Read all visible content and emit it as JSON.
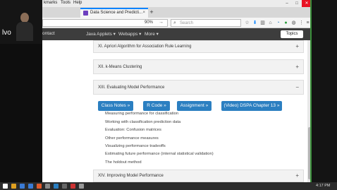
{
  "webcam": {
    "name": "lvo"
  },
  "menubar": {
    "items": [
      "kmarks",
      "Tools",
      "Help"
    ]
  },
  "window_controls": {
    "minimize": "–",
    "maximize": "□",
    "close": "✕"
  },
  "tab": {
    "title": "Data Science and Predicti...",
    "close": "×"
  },
  "newtab": "+",
  "navbar": {
    "zoom": "90%",
    "go": "→",
    "search_placeholder": "Search"
  },
  "site_nav": {
    "items": [
      "ontact",
      "Java Applets ▾",
      "Webapps ▾",
      "More ▾"
    ],
    "topics_button": "Topics"
  },
  "sections": [
    {
      "title": "XI. Apriori Algorithm for Association Rule Learning",
      "toggle": "+"
    },
    {
      "title": "XII. k-Means Clustering",
      "toggle": "+"
    },
    {
      "title": "XIII. Evaluating Model Performance",
      "toggle": "−"
    },
    {
      "title": "XIV. Improving Model Performance",
      "toggle": "+"
    }
  ],
  "buttons": [
    "Class Notes »",
    "R Code »",
    "Assignment »",
    "(Video) DSPA Chapter 13 »"
  ],
  "topics": [
    "Measuring performance for classification",
    "Working with classification prediction data",
    "Evaluation: Confusion matrices",
    "Other performance measures",
    "Visualizing performance tradeoffs",
    "Estimating future performance (internal statistical validation)",
    "The holdout method"
  ],
  "taskbar": {
    "clock_line1": "4:17 PM",
    "clock_line2": ""
  },
  "colors": {
    "accent_blue": "#2b7fc1",
    "nav_dark": "#3d3d3d",
    "tab_accent": "#0a84ff"
  }
}
